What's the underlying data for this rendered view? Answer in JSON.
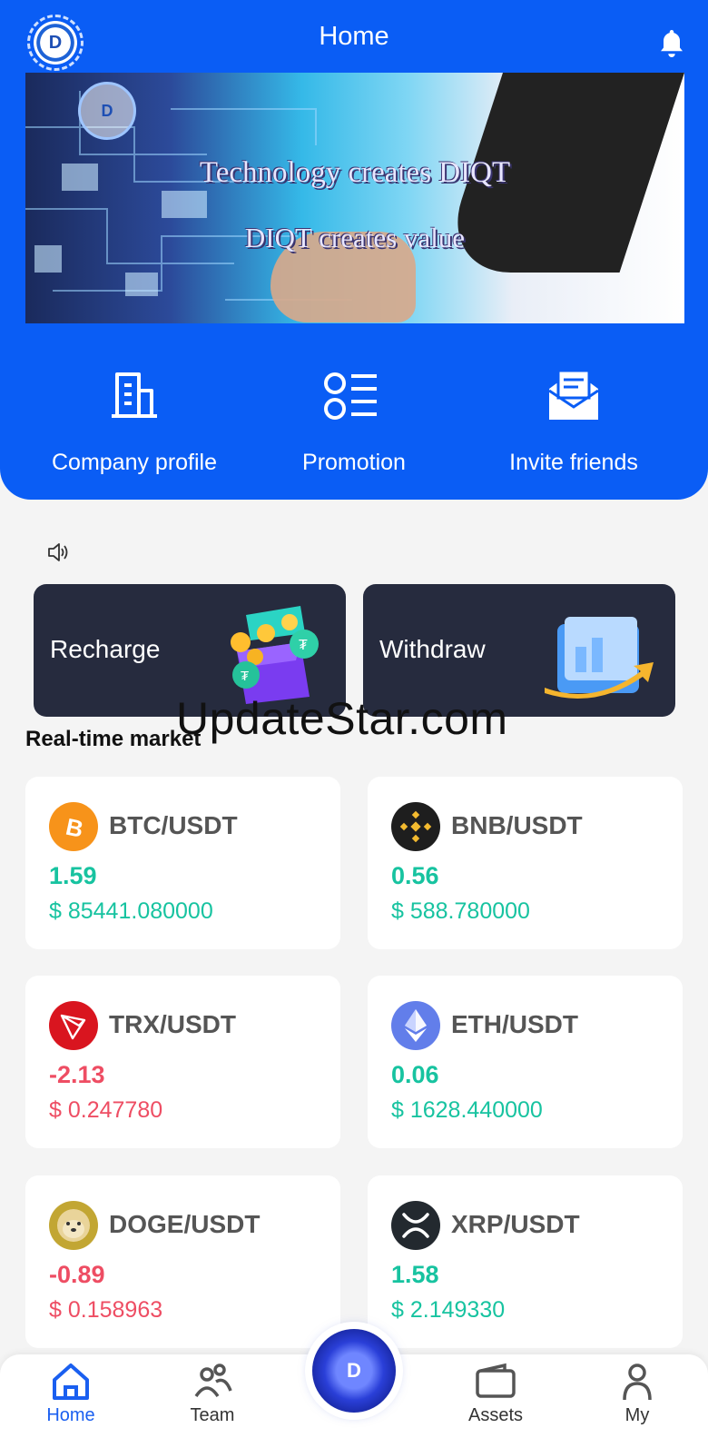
{
  "header": {
    "title": "Home",
    "logo_letter": "D"
  },
  "banner": {
    "logo_letter": "D",
    "line1": "Technology creates DIQT",
    "line2": "DIQT creates value"
  },
  "quick_actions": [
    {
      "label": "Company profile",
      "icon": "building-icon"
    },
    {
      "label": "Promotion",
      "icon": "list-icon"
    },
    {
      "label": "Invite friends",
      "icon": "envelope-icon"
    }
  ],
  "actions": {
    "recharge": "Recharge",
    "withdraw": "Withdraw"
  },
  "watermark": "UpdateStar.com",
  "market": {
    "title": "Real-time market",
    "items": [
      {
        "pair": "BTC/USDT",
        "change": "1.59",
        "price": "$ 85441.080000",
        "trend": "up",
        "icon": "bitcoin-icon",
        "color": "#f7931a"
      },
      {
        "pair": "BNB/USDT",
        "change": "0.56",
        "price": "$ 588.780000",
        "trend": "up",
        "icon": "bnb-icon",
        "color": "#1e1e1e"
      },
      {
        "pair": "TRX/USDT",
        "change": "-2.13",
        "price": "$ 0.247780",
        "trend": "down",
        "icon": "tron-icon",
        "color": "#d9151f"
      },
      {
        "pair": "ETH/USDT",
        "change": "0.06",
        "price": "$ 1628.440000",
        "trend": "up",
        "icon": "ethereum-icon",
        "color": "#627eea"
      },
      {
        "pair": "DOGE/USDT",
        "change": "-0.89",
        "price": "$ 0.158963",
        "trend": "down",
        "icon": "doge-icon",
        "color": "#c2a633"
      },
      {
        "pair": "XRP/USDT",
        "change": "1.58",
        "price": "$ 2.149330",
        "trend": "up",
        "icon": "xrp-icon",
        "color": "#23292f"
      }
    ]
  },
  "tabbar": {
    "home": "Home",
    "team": "Team",
    "center_letter": "D",
    "assets": "Assets",
    "my": "My"
  },
  "colors": {
    "brand_blue": "#0a5df5",
    "up": "#17c3a0",
    "down": "#ee4d63",
    "card_dark": "#262b3e"
  }
}
